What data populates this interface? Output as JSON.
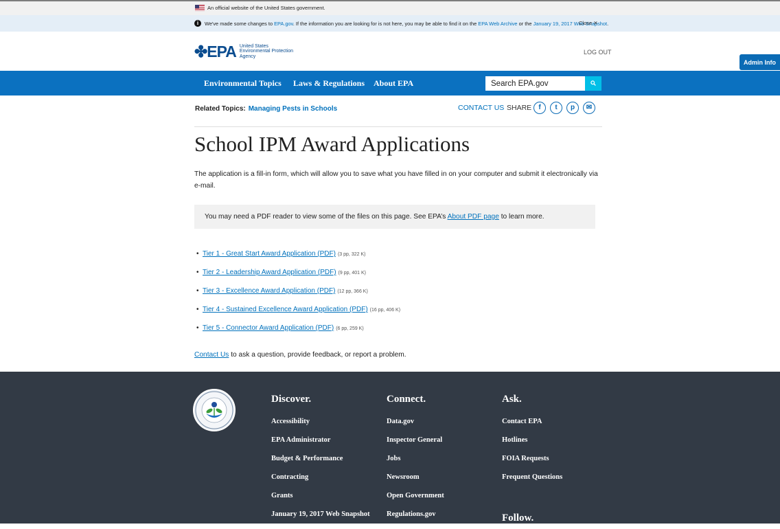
{
  "gov_banner": {
    "text": "An official website of the United States government."
  },
  "notice": {
    "prefix": "We've made some changes to ",
    "link1": "EPA.gov",
    "middle": ". If the information you are looking for is not here, you may be able to find it on the ",
    "link2": "EPA Web Archive",
    "or": " or the ",
    "link3": "January 19, 2017 Web Snapshot",
    "suffix": ".",
    "close_label": "Close ✕"
  },
  "header": {
    "logo_mark": "✤EPA",
    "agency_line1": "United States",
    "agency_line2": "Environmental Protection",
    "agency_line3": "Agency",
    "logout": "LOG OUT",
    "admin_button": "Admin Info"
  },
  "nav": {
    "items": [
      "Environmental Topics",
      "Laws & Regulations",
      "About EPA"
    ],
    "search_value": "Search EPA.gov"
  },
  "related": {
    "label": "Related Topics:",
    "link": "Managing Pests in Schools",
    "contact": "CONTACT US",
    "share": "SHARE",
    "social": [
      "f",
      "t",
      "p",
      "✉"
    ]
  },
  "main": {
    "title": "School IPM Award Applications",
    "intro": "The application is a fill-in form, which will allow you to save what you have filled in on your computer and submit it electronically via e-mail.",
    "pdf_note_prefix": "You may need a PDF reader to view some of the files on this page. See EPA’s ",
    "pdf_note_link": "About PDF page",
    "pdf_note_suffix": " to learn more.",
    "links": [
      {
        "label": "Tier 1 - Great Start Award Application (PDF)",
        "meta": "(3 pp, 322 K)"
      },
      {
        "label": "Tier 2 - Leadership Award Application (PDF)",
        "meta": "(9 pp, 401 K)"
      },
      {
        "label": "Tier 3 - Excellence Award Application (PDF)",
        "meta": "(12 pp, 366 K)"
      },
      {
        "label": "Tier 4 - Sustained Excellence Award Application (PDF)",
        "meta": "(16 pp, 406 K)"
      },
      {
        "label": "Tier 5 - Connector Award Application (PDF)",
        "meta": "(6 pp, 259 K)"
      }
    ],
    "contact_link": "Contact Us",
    "contact_suffix": " to ask a question, provide feedback, or report a problem."
  },
  "footer": {
    "discover": {
      "heading": "Discover.",
      "links": [
        "Accessibility",
        "EPA Administrator",
        "Budget & Performance",
        "Contracting",
        "Grants",
        "January 19, 2017 Web Snapshot"
      ]
    },
    "connect": {
      "heading": "Connect.",
      "links": [
        "Data.gov",
        "Inspector General",
        "Jobs",
        "Newsroom",
        "Open Government",
        "Regulations.gov"
      ]
    },
    "ask": {
      "heading": "Ask.",
      "links": [
        "Contact EPA",
        "Hotlines",
        "FOIA Requests",
        "Frequent Questions"
      ]
    },
    "follow": "Follow."
  },
  "colors": {
    "nav_blue": "#0b71c0",
    "link_blue": "#0071bc",
    "footer_bg": "#323a45",
    "search_button": "#02bfe7"
  }
}
